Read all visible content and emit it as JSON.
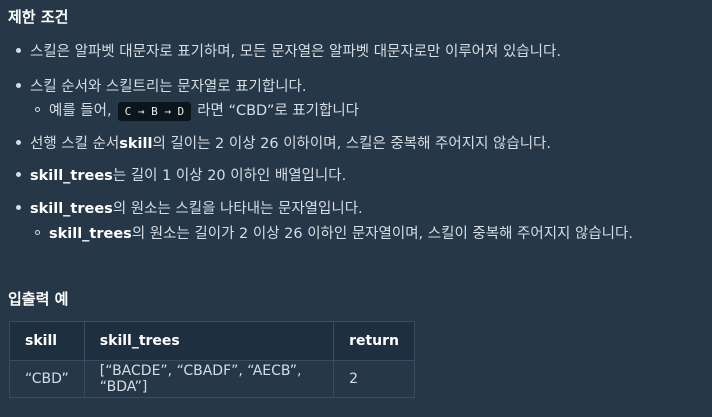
{
  "section_title": "제한 조건",
  "rules": [
    {
      "text": "스킬은 알파벳 대문자로 표기하며, 모든 문자열은 알파벳 대문자로만 이루어져 있습니다."
    },
    {
      "text": "스킬 순서와 스킬트리는 문자열로 표기합니다."
    },
    {
      "sub_prefix": "예를 들어,",
      "code": "C → B → D",
      "sub_suffix": "라면 “CBD”로 표기합니다"
    },
    {
      "bold": "skill",
      "prefix": "선행 스킬 순서 ",
      "suffix": "의 길이는 2 이상 26 이하이며, 스킬은 중복해 주어지지 않습니다."
    },
    {
      "bold": "skill_trees",
      "suffix": "는 길이 1 이상 20 이하인 배열입니다."
    },
    {
      "bold": "skill_trees",
      "suffix": "의 원소는 스킬을 나타내는 문자열입니다."
    },
    {
      "bold": "skill_trees",
      "suffix": "의 원소는 길이가 2 이상 26 이하인 문자열이며, 스킬이 중복해 주어지지 않습니다."
    }
  ],
  "example_title": "입출력 예",
  "table": {
    "headers": [
      "skill",
      "skill_trees",
      "return"
    ],
    "rows": [
      [
        "“CBD”",
        "[“BACDE”, “CBADF”, “AECB”, “BDA”]",
        "2"
      ]
    ]
  }
}
